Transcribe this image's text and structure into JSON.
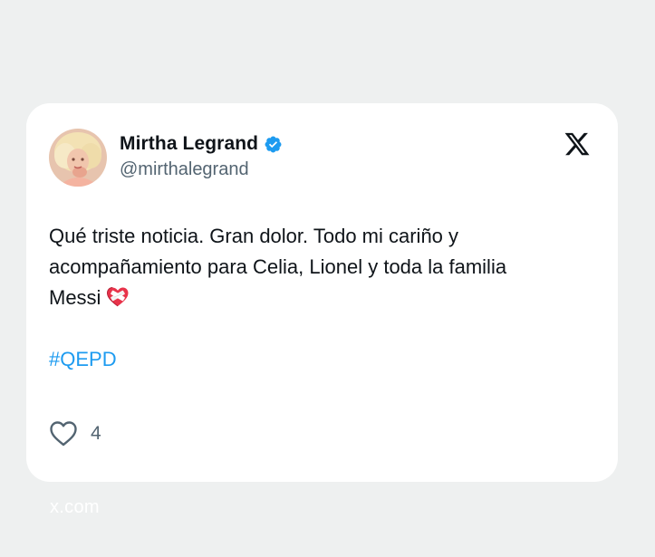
{
  "tweet": {
    "display_name": "Mirtha Legrand",
    "handle": "@mirthalegrand",
    "text_lines": [
      "Qué triste noticia. Gran dolor. Todo mi cariño y",
      "acompañamiento para Celia, Lionel y toda la familia",
      "Messi"
    ],
    "hashtag": "#QEPD",
    "like_count": "4",
    "icons": {
      "verified": "verified-badge-icon",
      "platform": "x-logo-icon",
      "emoji": "mending-heart-emoji",
      "like": "heart-outline-icon"
    }
  },
  "footer": {
    "source": "x.com"
  },
  "colors": {
    "background": "#eef0f0",
    "card": "#ffffff",
    "text": "#0f1419",
    "secondary_text": "#536471",
    "accent": "#1d9bf0"
  }
}
